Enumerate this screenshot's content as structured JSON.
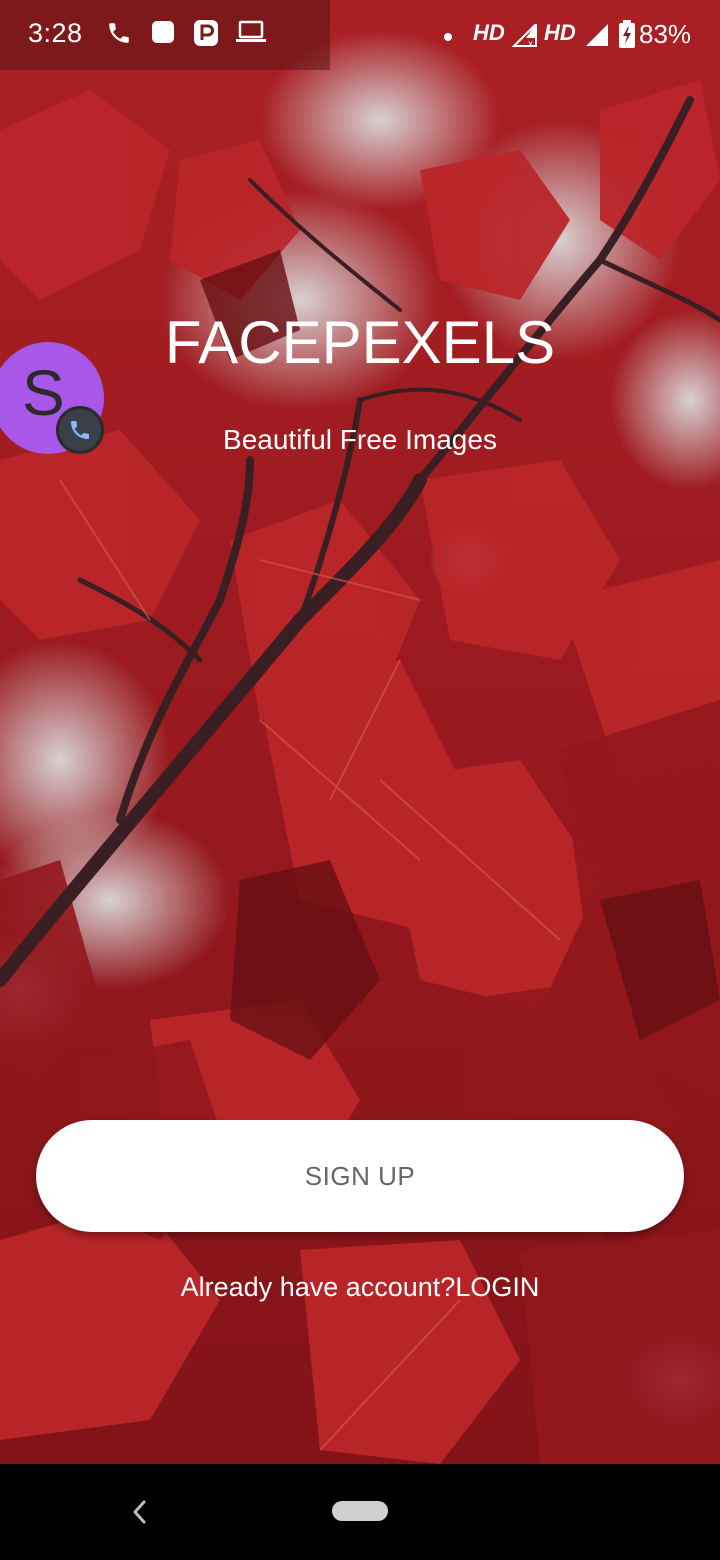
{
  "status_bar": {
    "time": "3:28",
    "network_label_1": "HD",
    "network_label_2": "HD",
    "battery": "83%"
  },
  "app": {
    "title": "FACEPEXELS",
    "subtitle": "Beautiful Free Images"
  },
  "chat_head": {
    "letter": "S"
  },
  "actions": {
    "signup_label": "SIGN UP",
    "login_prompt": "Already have account?LOGIN"
  },
  "colors": {
    "chat_head_bg": "#a957e8",
    "button_bg": "#ffffff",
    "button_text": "#666666",
    "background_accent": "#c0282b"
  },
  "icons": [
    "phone-icon",
    "stop-icon",
    "parking-icon",
    "laptop-icon",
    "dot-icon",
    "signal-icon",
    "battery-icon",
    "back-icon"
  ]
}
